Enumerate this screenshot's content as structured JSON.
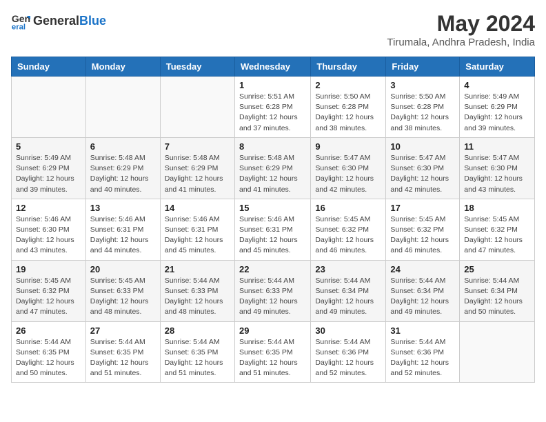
{
  "header": {
    "logo_general": "General",
    "logo_blue": "Blue",
    "month_year": "May 2024",
    "location": "Tirumala, Andhra Pradesh, India"
  },
  "weekdays": [
    "Sunday",
    "Monday",
    "Tuesday",
    "Wednesday",
    "Thursday",
    "Friday",
    "Saturday"
  ],
  "weeks": [
    [
      {
        "day": "",
        "info": ""
      },
      {
        "day": "",
        "info": ""
      },
      {
        "day": "",
        "info": ""
      },
      {
        "day": "1",
        "info": "Sunrise: 5:51 AM\nSunset: 6:28 PM\nDaylight: 12 hours and 37 minutes."
      },
      {
        "day": "2",
        "info": "Sunrise: 5:50 AM\nSunset: 6:28 PM\nDaylight: 12 hours and 38 minutes."
      },
      {
        "day": "3",
        "info": "Sunrise: 5:50 AM\nSunset: 6:28 PM\nDaylight: 12 hours and 38 minutes."
      },
      {
        "day": "4",
        "info": "Sunrise: 5:49 AM\nSunset: 6:29 PM\nDaylight: 12 hours and 39 minutes."
      }
    ],
    [
      {
        "day": "5",
        "info": "Sunrise: 5:49 AM\nSunset: 6:29 PM\nDaylight: 12 hours and 39 minutes."
      },
      {
        "day": "6",
        "info": "Sunrise: 5:48 AM\nSunset: 6:29 PM\nDaylight: 12 hours and 40 minutes."
      },
      {
        "day": "7",
        "info": "Sunrise: 5:48 AM\nSunset: 6:29 PM\nDaylight: 12 hours and 41 minutes."
      },
      {
        "day": "8",
        "info": "Sunrise: 5:48 AM\nSunset: 6:29 PM\nDaylight: 12 hours and 41 minutes."
      },
      {
        "day": "9",
        "info": "Sunrise: 5:47 AM\nSunset: 6:30 PM\nDaylight: 12 hours and 42 minutes."
      },
      {
        "day": "10",
        "info": "Sunrise: 5:47 AM\nSunset: 6:30 PM\nDaylight: 12 hours and 42 minutes."
      },
      {
        "day": "11",
        "info": "Sunrise: 5:47 AM\nSunset: 6:30 PM\nDaylight: 12 hours and 43 minutes."
      }
    ],
    [
      {
        "day": "12",
        "info": "Sunrise: 5:46 AM\nSunset: 6:30 PM\nDaylight: 12 hours and 43 minutes."
      },
      {
        "day": "13",
        "info": "Sunrise: 5:46 AM\nSunset: 6:31 PM\nDaylight: 12 hours and 44 minutes."
      },
      {
        "day": "14",
        "info": "Sunrise: 5:46 AM\nSunset: 6:31 PM\nDaylight: 12 hours and 45 minutes."
      },
      {
        "day": "15",
        "info": "Sunrise: 5:46 AM\nSunset: 6:31 PM\nDaylight: 12 hours and 45 minutes."
      },
      {
        "day": "16",
        "info": "Sunrise: 5:45 AM\nSunset: 6:32 PM\nDaylight: 12 hours and 46 minutes."
      },
      {
        "day": "17",
        "info": "Sunrise: 5:45 AM\nSunset: 6:32 PM\nDaylight: 12 hours and 46 minutes."
      },
      {
        "day": "18",
        "info": "Sunrise: 5:45 AM\nSunset: 6:32 PM\nDaylight: 12 hours and 47 minutes."
      }
    ],
    [
      {
        "day": "19",
        "info": "Sunrise: 5:45 AM\nSunset: 6:32 PM\nDaylight: 12 hours and 47 minutes."
      },
      {
        "day": "20",
        "info": "Sunrise: 5:45 AM\nSunset: 6:33 PM\nDaylight: 12 hours and 48 minutes."
      },
      {
        "day": "21",
        "info": "Sunrise: 5:44 AM\nSunset: 6:33 PM\nDaylight: 12 hours and 48 minutes."
      },
      {
        "day": "22",
        "info": "Sunrise: 5:44 AM\nSunset: 6:33 PM\nDaylight: 12 hours and 49 minutes."
      },
      {
        "day": "23",
        "info": "Sunrise: 5:44 AM\nSunset: 6:34 PM\nDaylight: 12 hours and 49 minutes."
      },
      {
        "day": "24",
        "info": "Sunrise: 5:44 AM\nSunset: 6:34 PM\nDaylight: 12 hours and 49 minutes."
      },
      {
        "day": "25",
        "info": "Sunrise: 5:44 AM\nSunset: 6:34 PM\nDaylight: 12 hours and 50 minutes."
      }
    ],
    [
      {
        "day": "26",
        "info": "Sunrise: 5:44 AM\nSunset: 6:35 PM\nDaylight: 12 hours and 50 minutes."
      },
      {
        "day": "27",
        "info": "Sunrise: 5:44 AM\nSunset: 6:35 PM\nDaylight: 12 hours and 51 minutes."
      },
      {
        "day": "28",
        "info": "Sunrise: 5:44 AM\nSunset: 6:35 PM\nDaylight: 12 hours and 51 minutes."
      },
      {
        "day": "29",
        "info": "Sunrise: 5:44 AM\nSunset: 6:35 PM\nDaylight: 12 hours and 51 minutes."
      },
      {
        "day": "30",
        "info": "Sunrise: 5:44 AM\nSunset: 6:36 PM\nDaylight: 12 hours and 52 minutes."
      },
      {
        "day": "31",
        "info": "Sunrise: 5:44 AM\nSunset: 6:36 PM\nDaylight: 12 hours and 52 minutes."
      },
      {
        "day": "",
        "info": ""
      }
    ]
  ]
}
